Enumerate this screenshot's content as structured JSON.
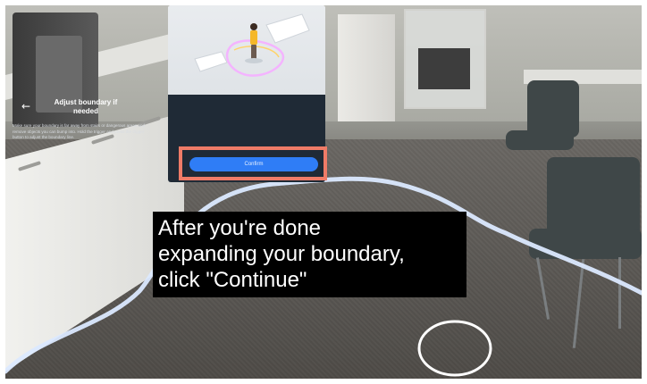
{
  "panel": {
    "title_line1": "Adjust boundary if",
    "title_line2": "needed",
    "description": "Make sure your boundary is far away from stairs or dangerous areas and remove objects you can bump into. Hold the trigger and press the trigger button to adjust the boundary line.",
    "confirm_label": "Confirm",
    "back_icon": "arrow-left-icon"
  },
  "caption": {
    "line1": "After you're done",
    "line2": "expanding your boundary,",
    "line3": "click \"Continue\""
  },
  "colors": {
    "highlight": "#ef7b67",
    "button": "#2f7df6",
    "panel_dark": "#1f2a36",
    "boundary_line": "#dbe9ff"
  }
}
